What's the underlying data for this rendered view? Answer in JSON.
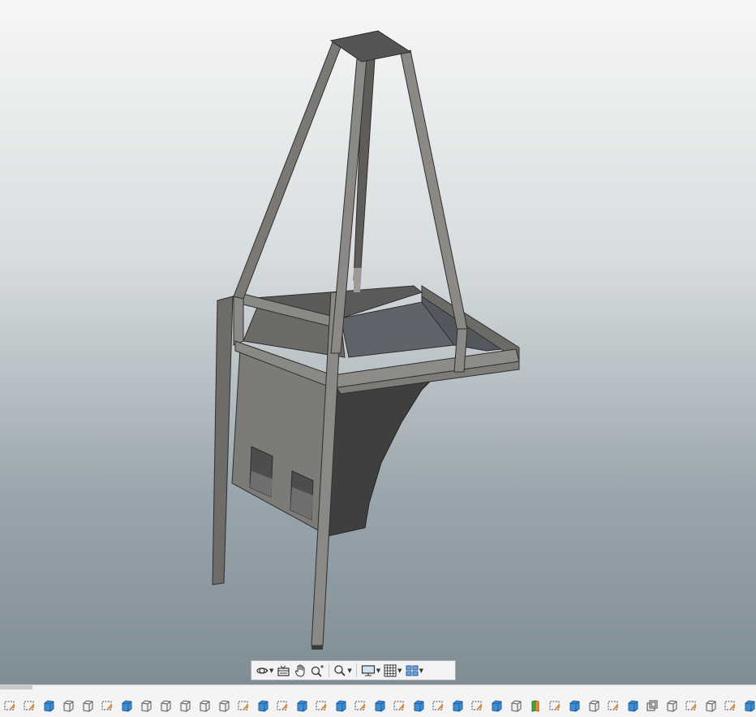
{
  "app": {
    "accent_color": "#3f8fd6"
  },
  "viewport": {
    "background_top": "#f6f7f7",
    "background_bottom": "#7f8d95",
    "model_colors": {
      "frame_light": "#8a8985",
      "frame_dark": "#4a4a4a",
      "panel": "#6f6e6a",
      "hopper_dark": "#3d3d3d",
      "top_plate": "#555555"
    }
  },
  "navigation_toolbar": {
    "tools": [
      {
        "name": "orbit-icon",
        "has_dropdown": true
      },
      {
        "name": "look-at-icon",
        "has_dropdown": false
      },
      {
        "name": "pan-icon",
        "has_dropdown": false
      },
      {
        "name": "zoom-window-icon",
        "has_dropdown": false
      },
      {
        "name": "zoom-icon",
        "has_dropdown": true
      },
      {
        "name": "display-settings-icon",
        "has_dropdown": true
      },
      {
        "name": "grid-settings-icon",
        "has_dropdown": true
      },
      {
        "name": "viewports-icon",
        "has_dropdown": true
      }
    ]
  },
  "timeline": {
    "items": [
      "sketch",
      "sketch",
      "extrude",
      "body",
      "body",
      "sketch",
      "extrude",
      "body",
      "body",
      "body",
      "body",
      "body",
      "sketch",
      "extrude",
      "sketch",
      "extrude",
      "sketch",
      "extrude",
      "sketch",
      "extrude",
      "sketch",
      "extrude",
      "sketch",
      "extrude",
      "sketch",
      "extrude",
      "body",
      "appearance",
      "sketch",
      "extrude",
      "body",
      "sketch",
      "extrude",
      "shell",
      "body",
      "sketch",
      "body",
      "sketch",
      "extrude"
    ]
  }
}
